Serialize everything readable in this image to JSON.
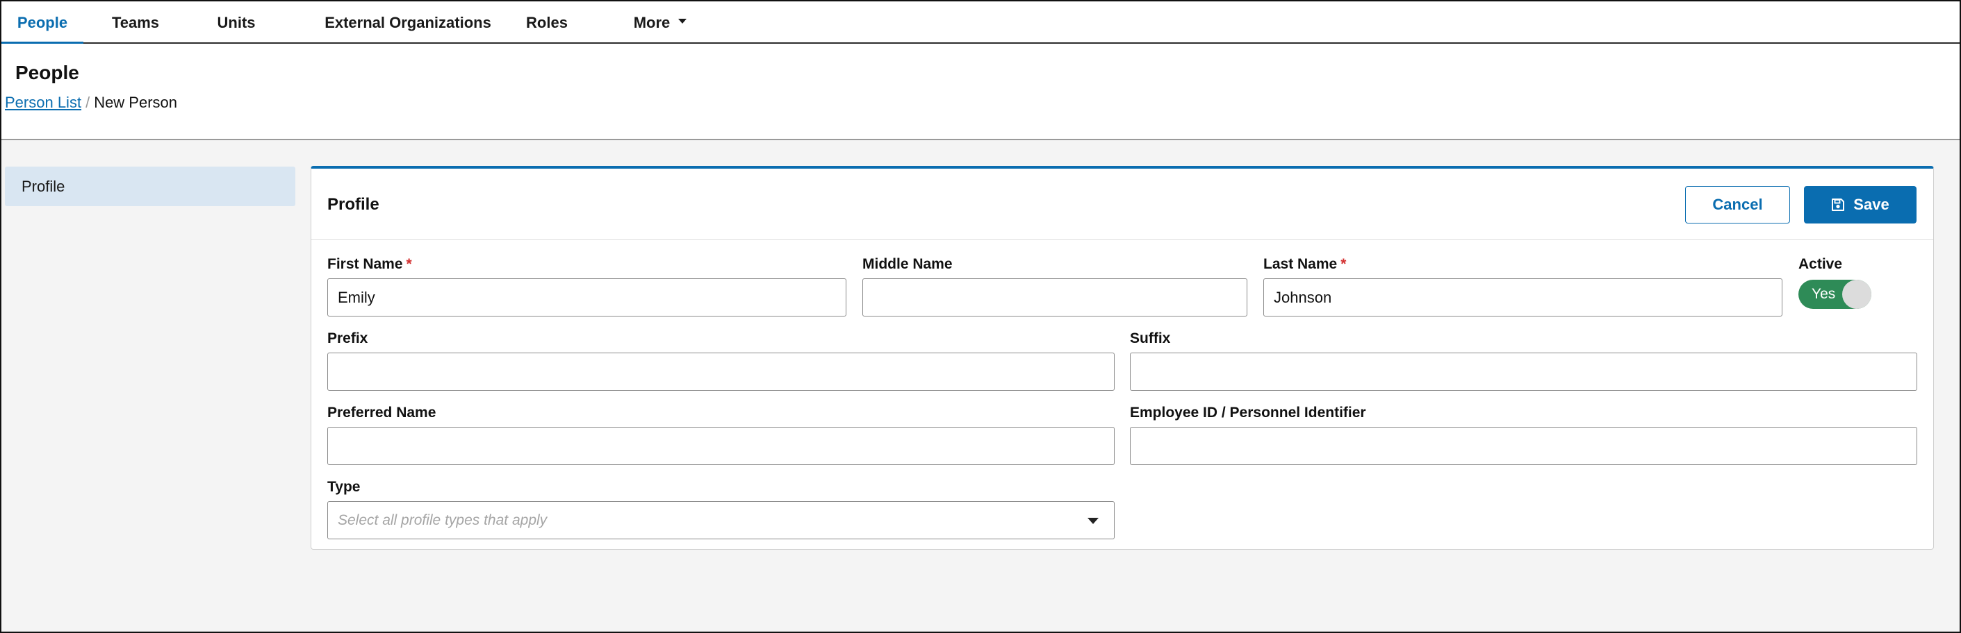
{
  "nav": {
    "tabs": [
      {
        "label": "People",
        "active": true
      },
      {
        "label": "Teams"
      },
      {
        "label": "Units"
      },
      {
        "label": "External Organizations"
      },
      {
        "label": "Roles"
      },
      {
        "label": "More"
      }
    ]
  },
  "header": {
    "title": "People",
    "breadcrumb": {
      "link": "Person List",
      "separator": "/",
      "current": "New Person"
    }
  },
  "sidebar": {
    "items": [
      {
        "label": "Profile",
        "selected": true
      }
    ]
  },
  "panel": {
    "title": "Profile",
    "cancel_label": "Cancel",
    "save_label": "Save",
    "save_icon": "floppy-disk-icon"
  },
  "form": {
    "required_marker": "*",
    "first_name": {
      "label": "First Name",
      "value": "Emily",
      "required": true
    },
    "middle_name": {
      "label": "Middle Name",
      "value": ""
    },
    "last_name": {
      "label": "Last Name",
      "value": "Johnson",
      "required": true
    },
    "active": {
      "label": "Active",
      "value": "Yes"
    },
    "prefix": {
      "label": "Prefix",
      "value": ""
    },
    "suffix": {
      "label": "Suffix",
      "value": ""
    },
    "preferred_name": {
      "label": "Preferred Name",
      "value": ""
    },
    "employee_id": {
      "label": "Employee ID / Personnel Identifier",
      "value": ""
    },
    "type": {
      "label": "Type",
      "placeholder": "Select all profile types that apply"
    }
  },
  "colors": {
    "accent": "#0a6db0",
    "toggle_on": "#2e8b57",
    "required": "#d32f2f",
    "sidebar_selected": "#d9e6f2"
  }
}
